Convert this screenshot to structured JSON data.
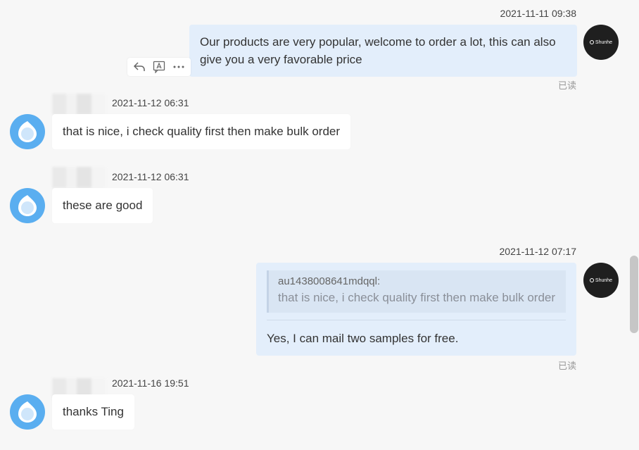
{
  "messages": [
    {
      "time": "2021-11-11 09:38",
      "text": "Our products are very popular, welcome to order a lot, this can also give you a very favorable price",
      "status": "已读"
    },
    {
      "time": "2021-11-12 06:31",
      "text": "that is nice, i check quality first then make bulk order"
    },
    {
      "time": "2021-11-12 06:31",
      "text": "these are good"
    },
    {
      "time": "2021-11-12 07:17",
      "quote_name": "au1438008641mdqql:",
      "quote_text": "that is nice, i check quality first then make bulk order",
      "text": "Yes, I can mail two samples for free.",
      "status": "已读"
    },
    {
      "time": "2021-11-16 19:51",
      "text": "thanks Ting"
    }
  ],
  "icons": {
    "reply": "reply-icon",
    "translate": "translate-icon",
    "more": "more-icon"
  },
  "colors": {
    "outgoing_bubble": "#e3eefb",
    "incoming_bubble": "#ffffff",
    "avatar_blue": "#5aaef0"
  }
}
